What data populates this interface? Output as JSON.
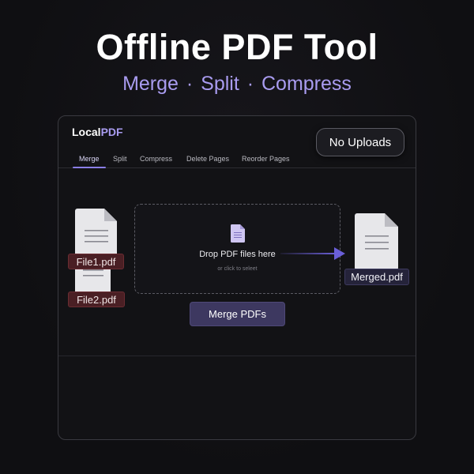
{
  "hero": {
    "title": "Offline PDF Tool",
    "subtitle": "Merge · Split · Compress"
  },
  "app": {
    "brand_prefix": "Local",
    "brand_suffix": "PDF",
    "badge": "No Uploads",
    "tabs": [
      {
        "label": "Merge",
        "active": true
      },
      {
        "label": "Split",
        "active": false
      },
      {
        "label": "Compress",
        "active": false
      },
      {
        "label": "Delete Pages",
        "active": false
      },
      {
        "label": "Reorder Pages",
        "active": false
      }
    ]
  },
  "drop_zone": {
    "title": "Drop PDF files here",
    "hint": "or click to seleet",
    "icon": "document-icon"
  },
  "input_files": [
    {
      "name": "File1.pdf",
      "icon": "document-icon"
    },
    {
      "name": "File2.pdf",
      "icon": "document-icon"
    }
  ],
  "output_file": {
    "name": "Merged.pdf",
    "icon": "document-icon"
  },
  "actions": {
    "merge_label": "Merge PDFs"
  },
  "colors": {
    "accent": "#a99cf0",
    "button": "#3d3860",
    "arrow": "#6a5fd8",
    "file_label_bg": "#4a1f24",
    "merged_label_bg": "#25233a"
  }
}
